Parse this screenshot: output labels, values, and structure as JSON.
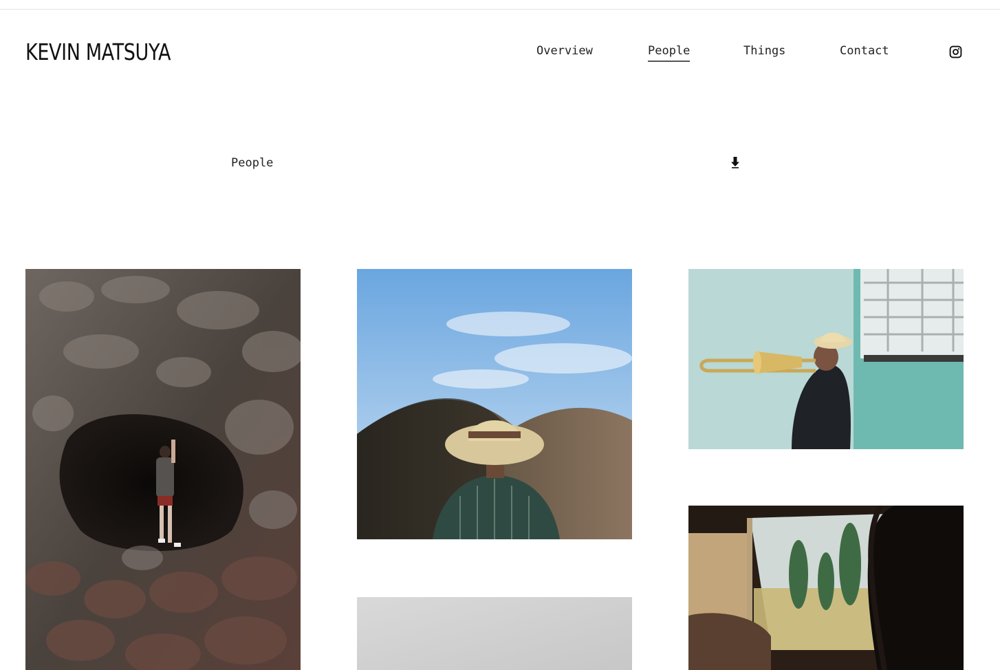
{
  "site": {
    "brand": "KEVIN MATSUYA"
  },
  "nav": {
    "items": [
      {
        "label": "Overview",
        "active": false
      },
      {
        "label": "People",
        "active": true
      },
      {
        "label": "Things",
        "active": false
      },
      {
        "label": "Contact",
        "active": false
      }
    ],
    "social_icon": "instagram-icon"
  },
  "section": {
    "label": "People",
    "scroll_icon": "arrow-down-icon"
  },
  "gallery": {
    "photos": [
      {
        "subject": "person-climbing-lava-cave"
      },
      {
        "subject": "person-in-straw-hat-desert-hills"
      },
      {
        "subject": "trombone-player-teal-wall"
      },
      {
        "subject": "grey-gradient-photo"
      },
      {
        "subject": "woman-in-car-window"
      }
    ]
  }
}
